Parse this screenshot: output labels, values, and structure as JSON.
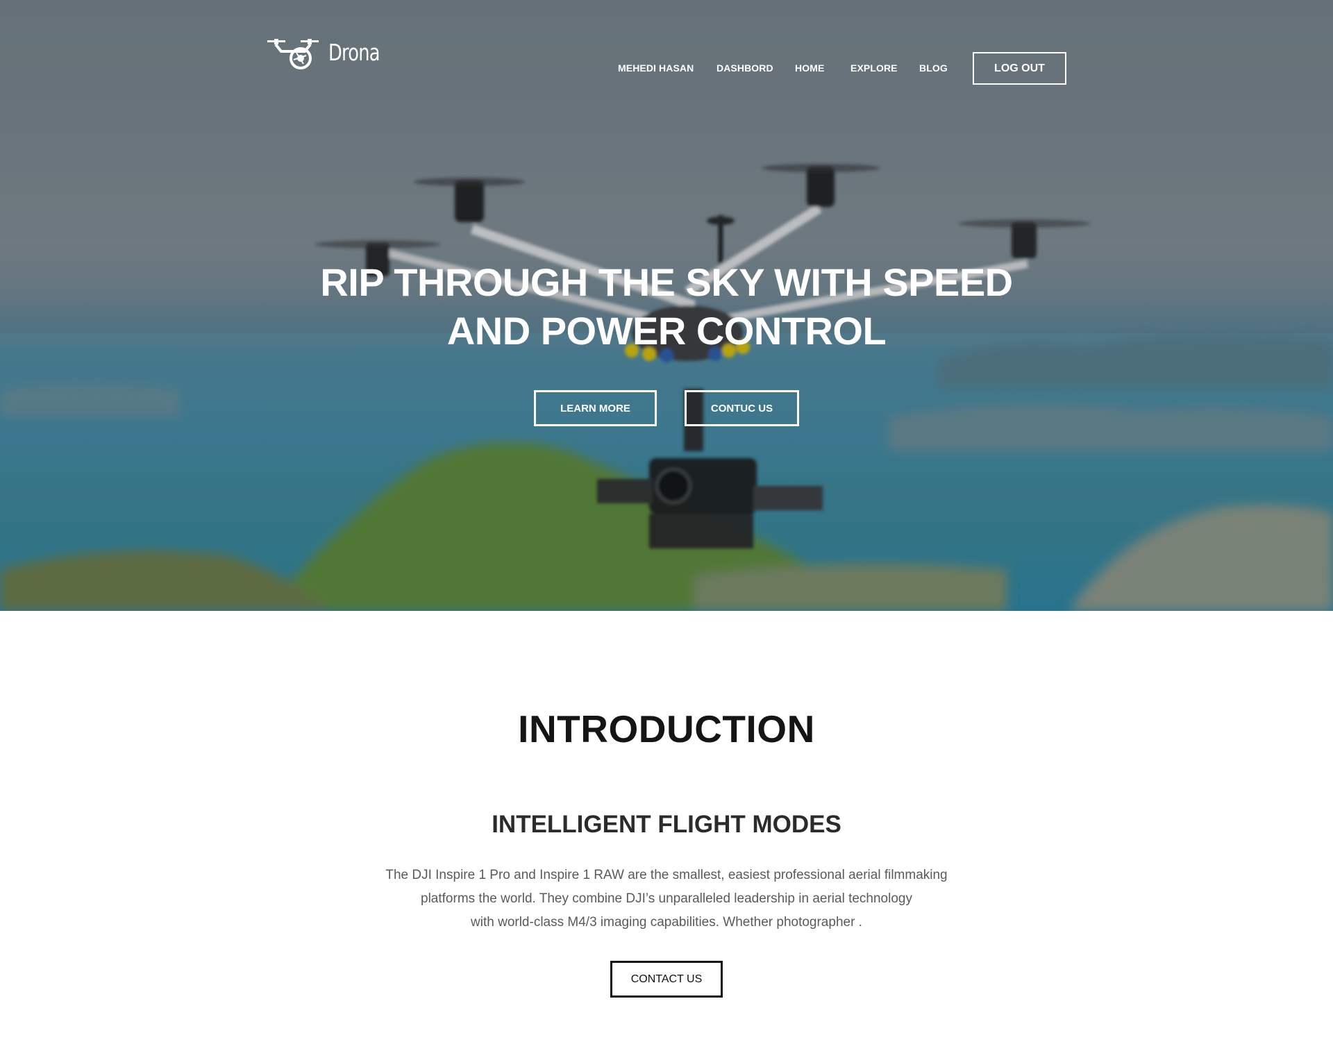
{
  "brand": {
    "name": "Drona",
    "logo_icon": "drone-camera-logo"
  },
  "nav": {
    "items": [
      {
        "label": "MEHEDI HASAN"
      },
      {
        "label": "DASHBORD"
      },
      {
        "label": "HOME"
      },
      {
        "label": "EXPLORE"
      },
      {
        "label": "BLOG"
      }
    ],
    "logout_label": "LOG OUT"
  },
  "hero": {
    "title_line1": "RIP THROUGH THE SKY WITH SPEED",
    "title_line2": "AND POWER CONTROL",
    "learn_more_label": "LEARN MORE",
    "contact_label": "CONTUC US"
  },
  "intro": {
    "title": "INTRODUCTION",
    "subtitle": "INTELLIGENT FLIGHT MODES",
    "paragraph_lines": [
      "The DJI Inspire 1 Pro and Inspire 1 RAW are the smallest, easiest professional aerial filmmaking",
      "platforms the world. They combine DJI’s unparalleled leadership in aerial technology",
      "with world-class M4/3 imaging capabilities. Whether photographer ."
    ],
    "contact_label": "CONTACT US"
  },
  "colors": {
    "hero_text": "#ffffff",
    "heading": "#151515",
    "body_text": "#5a5a5a"
  }
}
